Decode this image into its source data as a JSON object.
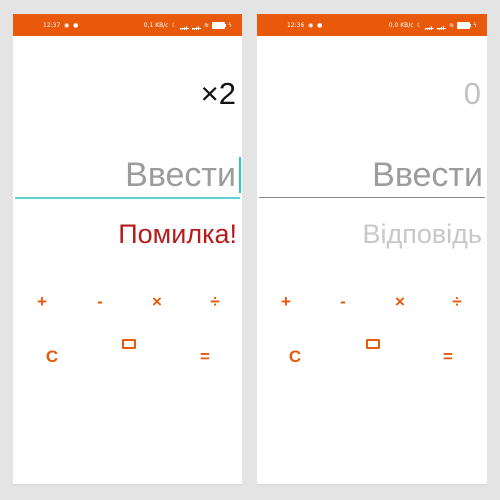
{
  "left_screen": {
    "status_bar": {
      "time": "12:37",
      "network_speed": "0,1 KB/c",
      "battery_label": ""
    },
    "result_text": "×2",
    "input_text": "Ввести",
    "answer_text": "Помилка!",
    "buttons": {
      "plus": "+",
      "minus": "-",
      "multiply": "×",
      "divide": "÷",
      "clear": "C",
      "equals": "="
    }
  },
  "right_screen": {
    "status_bar": {
      "time": "12:36",
      "network_speed": "0,0 KB/c",
      "battery_label": ""
    },
    "result_text": "0",
    "input_text": "Ввести",
    "answer_text": "Відповідь",
    "buttons": {
      "plus": "+",
      "minus": "-",
      "multiply": "×",
      "divide": "÷",
      "clear": "C",
      "equals": "="
    }
  },
  "colors": {
    "accent": "#e8590c",
    "error": "#b71c1c",
    "hint": "#9c9c9c",
    "focus_underline": "#5fd3d3"
  },
  "icons": {
    "backspace": "backspace-icon"
  }
}
